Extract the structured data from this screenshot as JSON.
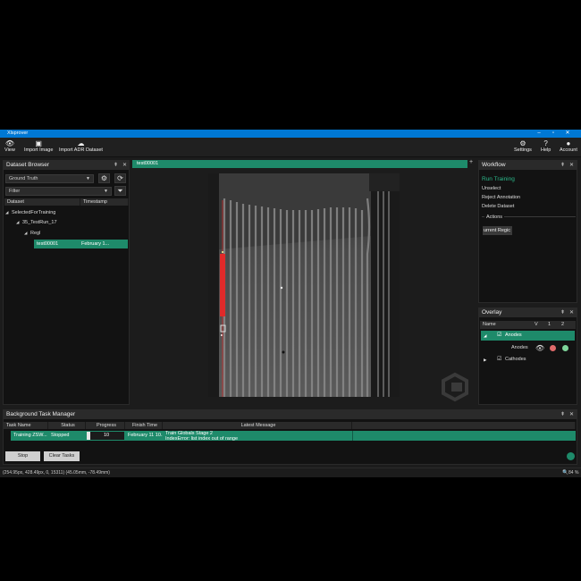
{
  "app": {
    "title": "Xlsprover"
  },
  "window_controls": {
    "minimize": "–",
    "maximize": "▫",
    "close": "✕"
  },
  "toolbar": {
    "left": [
      {
        "icon": "eye-icon",
        "glyph": "👁",
        "label": "View"
      },
      {
        "icon": "image-icon",
        "glyph": "▣",
        "label": "Import Image"
      },
      {
        "icon": "cloud-upload-icon",
        "glyph": "☁",
        "label": "Import ADR Dataset"
      }
    ],
    "right": [
      {
        "icon": "settings-icon",
        "glyph": "⚙",
        "label": "Settings"
      },
      {
        "icon": "help-icon",
        "glyph": "?",
        "label": "Help"
      },
      {
        "icon": "account-icon",
        "glyph": "●",
        "label": "Account"
      }
    ]
  },
  "dataset_browser": {
    "title": "Dataset Browser",
    "source_select": "Ground Truth",
    "filter_placeholder": "Filter",
    "columns": [
      "Dataset",
      "Timestamp"
    ],
    "tree": [
      {
        "label": "SelectedForTraining",
        "depth": 0
      },
      {
        "label": "35_TestRun_17",
        "depth": 1
      },
      {
        "label": "Regl",
        "depth": 2
      },
      {
        "label": "test00001",
        "timestamp": "February 1...",
        "depth": 3,
        "selected": true
      }
    ]
  },
  "viewer": {
    "tab": "test00001",
    "add_tab": "+"
  },
  "workflow": {
    "title": "Workflow",
    "primary_action": "Run Training",
    "actions": [
      "Unselect",
      "Reject Annotation",
      "Delete Dataset"
    ],
    "section_label": "Actions",
    "region_value": "urrent Regic"
  },
  "overlay": {
    "title": "Overlay",
    "col_name": "Name",
    "col_v": "V",
    "col_1": "1",
    "col_2": "2",
    "items": [
      {
        "label": "Anodes",
        "checked": true,
        "selected": true
      },
      {
        "label": "Anodes",
        "sub": true,
        "colors": [
          "#e06a6a",
          "#7ed49a"
        ]
      },
      {
        "label": "Cathodes",
        "checked": true
      }
    ]
  },
  "task_manager": {
    "title": "Background Task Manager",
    "columns": [
      "Task Name",
      "Status",
      "Progress",
      "Finish Time",
      "Latest Message"
    ],
    "rows": [
      {
        "name": "Training ZSW...",
        "status": "Stopped",
        "progress": "10",
        "progress_value": 0.1,
        "finish": "February 11 10...",
        "message": "Train Globals Stage 2",
        "message2": "IndexError: list index out of range"
      }
    ],
    "stop_label": "Stop",
    "clear_label": "Clear Tasks"
  },
  "status_bar": {
    "coords": "(254.95px, 428.49px, 0, 15311) (45.05mm, -78.49mm)",
    "zoom": "84 %"
  },
  "colors": {
    "accent": "#1e8a6a",
    "titlebar": "#0078d4",
    "annotation": "#e02a2a"
  }
}
